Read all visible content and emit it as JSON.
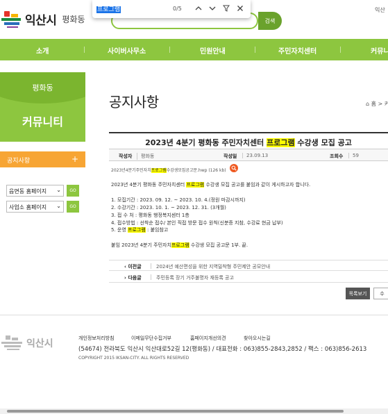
{
  "header": {
    "logo_text": "익산시",
    "logo_sub": "평화동",
    "search_button": "검색",
    "top_right": "익산"
  },
  "findbar": {
    "query": "프로그램",
    "count": "0/5",
    "up_icon": "chevron-up",
    "down_icon": "chevron-down",
    "filter_icon": "filter",
    "close_icon": "close"
  },
  "nav": {
    "items": [
      "소개",
      "사이버사무소",
      "민원안내",
      "주민자치센터",
      "커뮤니"
    ]
  },
  "sidebar": {
    "dong": "평화동",
    "title": "커뮤니티",
    "menu_item": "공지사항",
    "menu_plus": "+",
    "select1": "읍면동 홈페이지",
    "select2": "사업소 홈페이지",
    "go_label": "GO"
  },
  "content": {
    "page_title": "공지사항",
    "breadcrumb": "홈 > 커",
    "post": {
      "title_before": "2023년 4분기 평화동 주민자치센터 ",
      "title_highlight": "프로그램",
      "title_after": " 수강생 모집 공고",
      "author_label": "작성자",
      "author": "평화동",
      "date_label": "작성일",
      "date": "23.09.13",
      "views_label": "조회수",
      "views": "59",
      "attachment_before": "2023년4분기주민자치",
      "attachment_highlight": "프로그램",
      "attachment_after": "수강생모집공고문.hwp (126 kb)",
      "intro": "2023년 4분기 평화동 주민자치센터 ",
      "intro_hl": "프로그램",
      "intro_after": " 수강생 모집 공고를 붙임과 같이 게시하고자 합니다.",
      "line1": "1. 모집기간 : 2023. 09. 12. ~ 2023. 10. 4.(정원 마감시까지)",
      "line2": "2. 수강기간 : 2023. 10. 1. ~ 2023. 12. 31. (3개월)",
      "line3": "3. 접 수 처 : 평화동 행정복지센터 1층",
      "line4": "4. 접수방법 : 선착순 접수/ 본인 직접 방문 접수 원칙(신분증 지참, 수강료 현금 납부)",
      "line5_before": "5. 운영 ",
      "line5_hl": "프로그램",
      "line5_after": " : 붙임참고",
      "attach_note_before": "붙임  2023년 4분기 주민자치",
      "attach_note_hl": "프로그램",
      "attach_note_after": " 수강생 모집 공고문 1부.  끝."
    },
    "prev_label": "이전글",
    "prev_title": "2024년 예산편성을 위한 지역밀착형 주민제안 공모안내",
    "next_label": "다음글",
    "next_title": "주민등록 장기 거주불명자 재등록 공고",
    "list_button": "목록보기",
    "edit_button": "수"
  },
  "footer": {
    "logo_text": "익산시",
    "links": [
      "개인정보처리방침",
      "이메일무단수집거부",
      "홈페이지개선의견",
      "찾아오시는길"
    ],
    "address": "(54674) 전라북도 익산시 익산대로52길 12(평화동) / 대표전화 : 063)855-2843,2852 / 팩스 : 063)856-2613",
    "copyright": "COPYRIGHT 2015 IKSAN-CITY. ALL RIGHTS RESERVED"
  },
  "colors": {
    "green": "#8dc63f",
    "orange": "#f7a534",
    "highlight": "#ffff00"
  }
}
